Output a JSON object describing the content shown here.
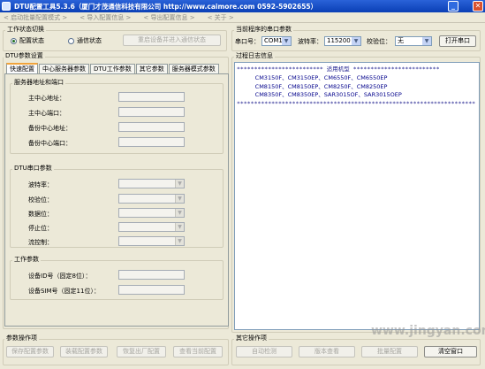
{
  "window": {
    "title": "DTU配置工具5.3.6（厦门才茂通信科技有限公司 http://www.caimore.com 0592-5902655）"
  },
  "menu": {
    "items": [
      "< 启动批量配置模式 >",
      "< 导入配置信息 >",
      "< 导出配置信息 >",
      "< 关于 >"
    ]
  },
  "work_state": {
    "title": "工作状态切换",
    "config_label": "配置状态",
    "comm_label": "通信状态",
    "restart_button": "重启设备并进入通信状态"
  },
  "serial": {
    "title": "当前程序的串口参数",
    "port_label": "串口号：",
    "port_value": "COM1",
    "baud_label": "波特率：",
    "baud_value": "115200",
    "parity_label": "校验位：",
    "parity_value": "无",
    "open_button": "打开串口"
  },
  "dtu_params": {
    "title": "DTU参数设置",
    "tabs": [
      "快速配置",
      "中心服务器参数",
      "DTU工作参数",
      "其它参数",
      "服务器模式参数"
    ],
    "server_group": {
      "title": "服务器地址和端口",
      "fields": [
        "主中心地址：",
        "主中心端口：",
        "备份中心地址：",
        "备份中心端口："
      ]
    },
    "serial_group": {
      "title": "DTU串口参数",
      "fields": [
        "波特率：",
        "校验位：",
        "数据位：",
        "停止位：",
        "流控制："
      ]
    },
    "work_group": {
      "title": "工作参数",
      "fields": [
        "设备ID号（固定8位）：",
        "设备SIM号（固定11位）："
      ]
    }
  },
  "log": {
    "title": "过程日志信息",
    "lines": [
      "************************* 适用机型 *************************",
      "          CM3150F、CM3150EP、CM6550F、CM6550EP",
      "          CM8150F、CM8150EP、CM8250F、CM8250EP",
      "          CM8350F、CM8350EP、SAR3015OF、SAR3015OEP",
      "*********************************************************************"
    ]
  },
  "param_ops": {
    "title": "参数操作项",
    "buttons": [
      "保存配置参数",
      "装载配置参数",
      "恢复出厂配置",
      "查看当前配置"
    ]
  },
  "other_ops": {
    "title": "其它操作项",
    "buttons": [
      "自动检测",
      "版本查看",
      "批量配置",
      "清空窗口"
    ]
  },
  "watermark": "www.jingyan.com"
}
